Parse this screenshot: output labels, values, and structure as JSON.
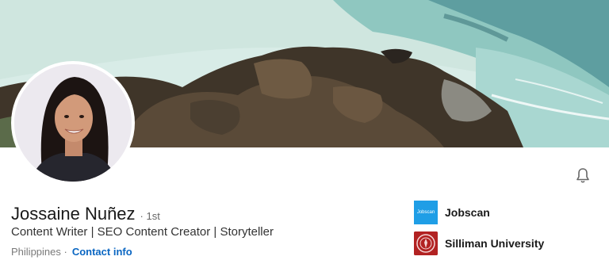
{
  "profile": {
    "name": "Jossaine Nuñez",
    "degree": "· 1st",
    "headline": "Content Writer | SEO Content Creator | Storyteller",
    "location": "Philippines ·",
    "contact_label": "Contact info"
  },
  "organizations": [
    {
      "name": "Jobscan",
      "logo_text": "Jobscan",
      "icon": "jobscan-logo"
    },
    {
      "name": "Silliman University",
      "icon": "silliman-seal"
    }
  ],
  "icons": {
    "notification": "bell-icon"
  },
  "colors": {
    "link": "#0a66c2",
    "jobscan_brand": "#1f9ee6",
    "silliman_brand": "#b22222"
  }
}
